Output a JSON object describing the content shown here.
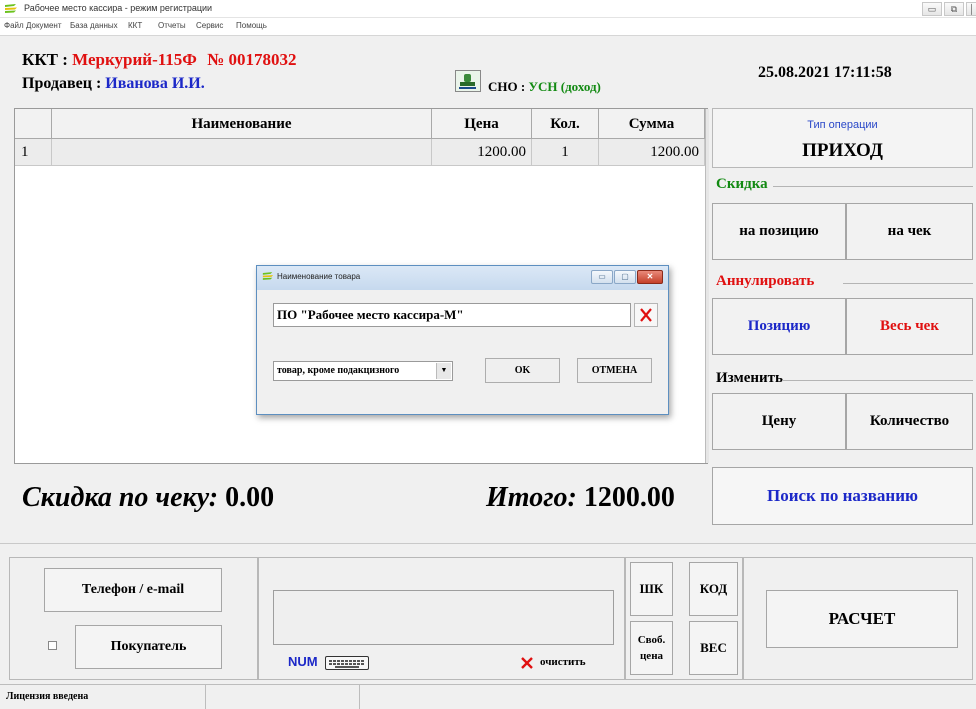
{
  "window": {
    "title": "Рабочее место кассира - режим регистрации",
    "minimize_glyph": "▭",
    "maximize_glyph": "⧉",
    "close_glyph": "│"
  },
  "menu": [
    "Файл",
    "Документ",
    "База данных",
    "ККТ",
    "Отчеты",
    "Сервис",
    "Помощь"
  ],
  "header": {
    "kkt_label": "ККТ :",
    "kkt_model": "Меркурий-115Ф",
    "kkt_number": "№ 00178032",
    "seller_label": "Продавец :",
    "seller_name": "Иванова И.И.",
    "sno_label": "СНО :",
    "sno_value": "УСН (доход)",
    "datetime": "25.08.2021  17:11:58"
  },
  "table": {
    "columns": [
      "",
      "Наименование",
      "Цена",
      "Кол.",
      "Сумма"
    ],
    "rows": [
      {
        "num": "1",
        "name": "",
        "price": "1200.00",
        "qty": "1",
        "sum": "1200.00"
      }
    ]
  },
  "dialog": {
    "title": "Наименование товара",
    "name_value": "ПО \"Рабочее место кассира-М\"",
    "type_value": "товар, кроме подакцизного",
    "select_arrow": "▼",
    "ok_label": "OK",
    "cancel_label": "ОТМЕНА",
    "minimize_glyph": "▭",
    "maximize_glyph": "▢",
    "close_glyph": "✕"
  },
  "right_panel": {
    "operation_type_label": "Тип операции",
    "operation_type_value": "ПРИХОД",
    "discount_label": "Скидка",
    "discount_position": "на позицию",
    "discount_check": "на чек",
    "cancel_label": "Аннулировать",
    "cancel_position": "Позицию",
    "cancel_check": "Весь чек",
    "change_label": "Изменить",
    "change_price": "Цену",
    "change_qty": "Количество",
    "search_label": "Поиск по названию"
  },
  "totals": {
    "discount_label": "Скидка по чеку:",
    "discount_value": "0.00",
    "total_label": "Итого:",
    "total_value": "1200.00"
  },
  "bottom": {
    "phone_email": "Телефон / e-mail",
    "buyer": "Покупатель",
    "num_label": "NUM",
    "clear_label": "очистить",
    "shk": "ШК",
    "kod": "КОД",
    "svob_cena": "Своб. цена",
    "ves": "ВЕС",
    "pay": "РАСЧЕТ"
  },
  "status": {
    "text": "Лицензия введена"
  },
  "colors": {
    "red": "#e01010",
    "blue": "#1c28c8",
    "green": "#128a12"
  }
}
